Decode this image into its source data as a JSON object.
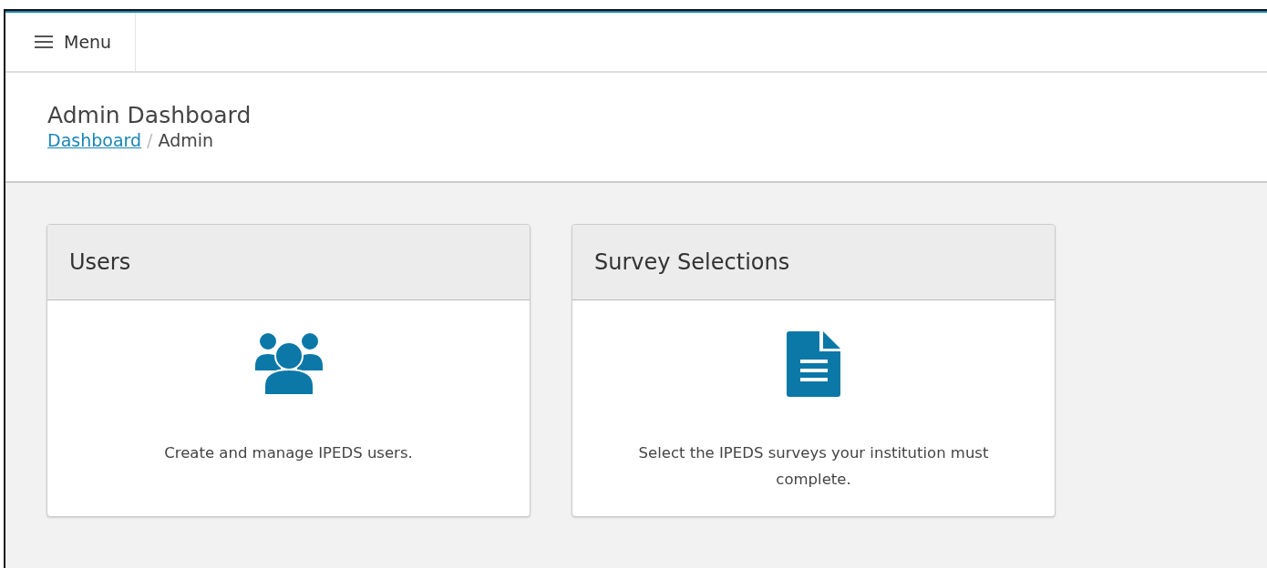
{
  "topbar": {
    "menu_label": "Menu"
  },
  "header": {
    "title": "Admin Dashboard",
    "breadcrumb": [
      {
        "label": "Dashboard",
        "kind": "link"
      },
      {
        "label": "Admin",
        "kind": "current"
      }
    ],
    "separator": "/"
  },
  "cards": [
    {
      "title": "Users",
      "kind": "users",
      "description": "Create and manage IPEDS users."
    },
    {
      "title": "Survey Selections",
      "kind": "document",
      "description": "Select the IPEDS surveys your institution must complete."
    }
  ]
}
